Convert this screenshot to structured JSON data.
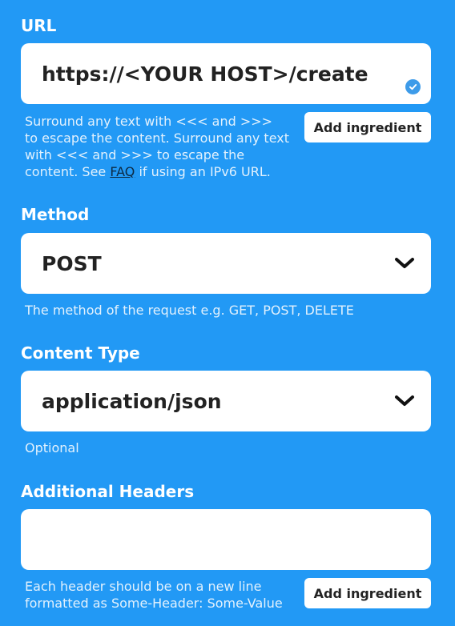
{
  "url": {
    "label": "URL",
    "value": "https://<YOUR HOST>/create",
    "help_before_link": "Surround any text with <<< and >>> to escape the content. Surround any text with <<< and >>> to escape the content. See ",
    "help_link": "FAQ",
    "help_after_link": " if using an IPv6 URL.",
    "add_ingredient_label": "Add ingredient"
  },
  "method": {
    "label": "Method",
    "value": "POST",
    "help": "The method of the request e.g. GET, POST, DELETE"
  },
  "content_type": {
    "label": "Content Type",
    "value": "application/json",
    "help": "Optional"
  },
  "additional_headers": {
    "label": "Additional Headers",
    "value": "",
    "help": "Each header should be on a new line formatted as Some-Header: Some-Value",
    "add_ingredient_label": "Add ingredient"
  },
  "colors": {
    "background": "#2299f5",
    "field": "#ffffff",
    "check": "#3d9be9",
    "help_text": "#e2f1fd"
  },
  "icons": {
    "valid": "check-circle-icon",
    "dropdown": "chevron-down-icon"
  }
}
